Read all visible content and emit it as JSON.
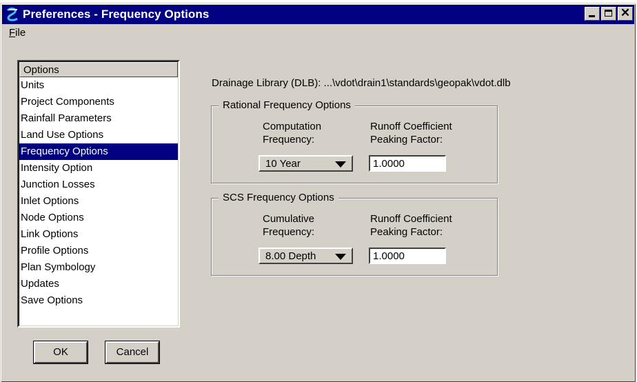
{
  "window": {
    "title": "Preferences - Frequency Options",
    "app_icon": "geopak-icon"
  },
  "menu": {
    "file_label": "File"
  },
  "options_list": {
    "header": "Options",
    "items": [
      "Units",
      "Project Components",
      "Rainfall Parameters",
      "Land Use Options",
      "Frequency Options",
      "Intensity Option",
      "Junction Losses",
      "Inlet Options",
      "Node Options",
      "Link Options",
      "Profile Options",
      "Plan Symbology",
      "Updates",
      "Save Options"
    ],
    "selected_index": 4
  },
  "buttons": {
    "ok": "OK",
    "cancel": "Cancel"
  },
  "dlb_path": "Drainage Library (DLB):  ...\\vdot\\drain1\\standards\\geopak\\vdot.dlb",
  "rational": {
    "legend": "Rational Frequency Options",
    "freq_label_1": "Computation",
    "freq_label_2": "Frequency:",
    "coef_label_1": "Runoff Coefficient",
    "coef_label_2": "Peaking Factor:",
    "frequency_value": "10 Year",
    "coefficient_value": "1.0000"
  },
  "scs": {
    "legend": "SCS Frequency Options",
    "freq_label_1": "Cumulative",
    "freq_label_2": "Frequency:",
    "coef_label_1": "Runoff Coefficient",
    "coef_label_2": "Peaking Factor:",
    "frequency_value": "8.00 Depth",
    "coefficient_value": "1.0000"
  }
}
